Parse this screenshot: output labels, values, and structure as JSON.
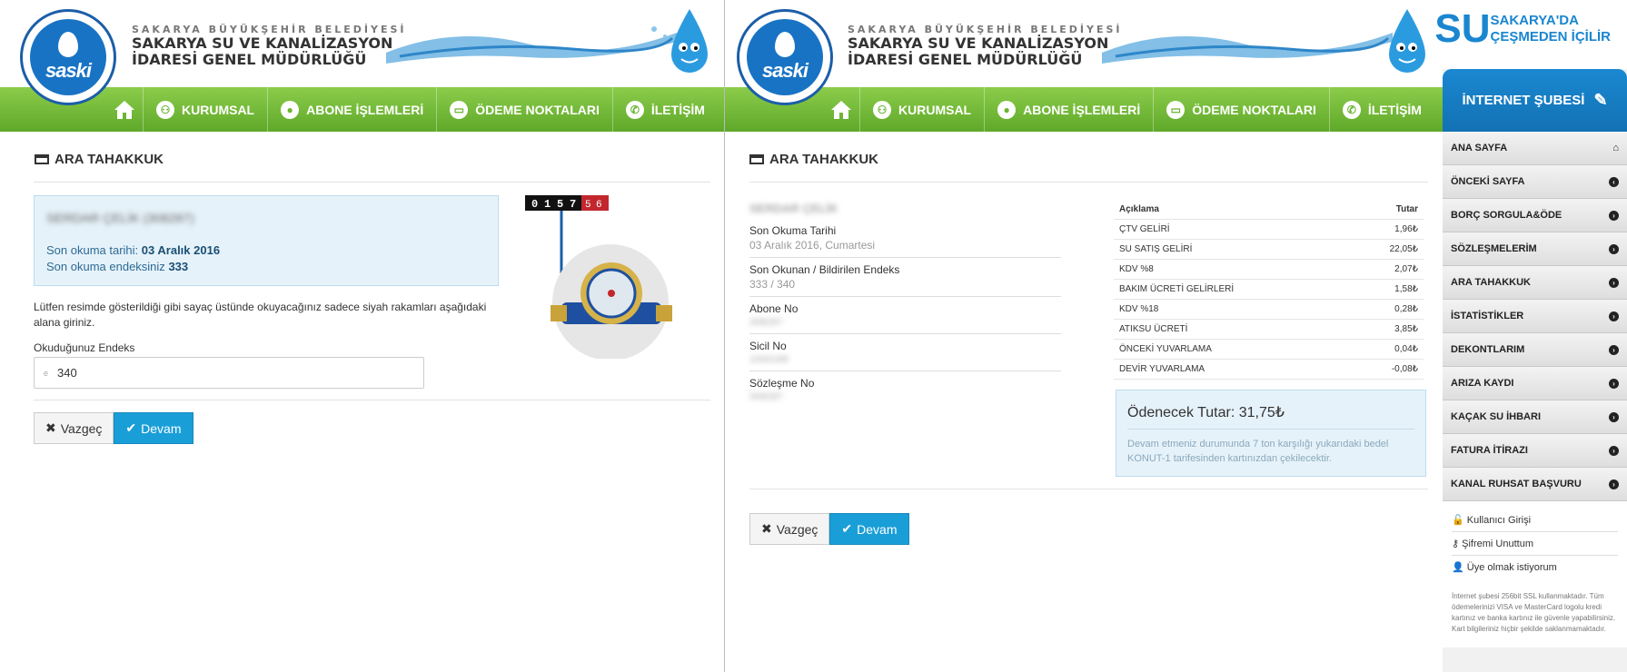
{
  "header": {
    "logo_text": "saski",
    "org_small": "SAKARYA BÜYÜKŞEHİR BELEDİYESİ",
    "org_line1": "SAKARYA SU VE KANALİZASYON",
    "org_line2": "İDARESİ GENEL MÜDÜRLÜĞÜ",
    "slogan_su": "SU",
    "slogan_line1": "SAKARYA'DA",
    "slogan_line2": "ÇEŞMEDEN İÇİLİR"
  },
  "nav": {
    "items": [
      "KURUMSAL",
      "ABONE İŞLEMLERİ",
      "ÖDEME NOKTALARI",
      "İLETİŞİM"
    ]
  },
  "left": {
    "title": "ARA TAHAKKUK",
    "customer_name": "SERDAR ÇELİK (308287)",
    "last_read_label": "Son okuma tarihi:",
    "last_read_value": "03 Aralık 2016",
    "last_index_label": "Son okuma endeksiniz",
    "last_index_value": "333",
    "instruction": "Lütfen resimde gösterildiği gibi sayaç üstünde okuyacağınız sadece siyah rakamları aşağıdaki alana giriniz.",
    "input_label": "Okuduğunuz Endeks",
    "input_prefix": "e",
    "input_value": "340",
    "meter_digits_black": [
      "0",
      "1",
      "5",
      "7"
    ],
    "meter_digits_red": [
      "5",
      "6"
    ],
    "cancel": "Vazgeç",
    "continue": "Devam"
  },
  "right": {
    "title": "ARA TAHAKKUK",
    "customer_name": "SERDAR ÇELİK",
    "fields": [
      {
        "key": "Son Okuma Tarihi",
        "value": "03 Aralık 2016, Cumartesi",
        "blur": false
      },
      {
        "key": "Son Okunan / Bildirilen Endeks",
        "value": "333 / 340",
        "blur": false
      },
      {
        "key": "Abone No",
        "value": "308287",
        "blur": true
      },
      {
        "key": "Sicil No",
        "value": "1000189",
        "blur": true
      },
      {
        "key": "Sözleşme No",
        "value": "308287",
        "blur": true
      }
    ],
    "table_head": {
      "desc": "Açıklama",
      "amount": "Tutar"
    },
    "table_rows": [
      {
        "desc": "ÇTV GELİRİ",
        "amount": "1,96₺"
      },
      {
        "desc": "SU SATIŞ GELİRİ",
        "amount": "22,05₺"
      },
      {
        "desc": "KDV %8",
        "amount": "2,07₺"
      },
      {
        "desc": "BAKIM ÜCRETİ GELİRLERİ",
        "amount": "1,58₺"
      },
      {
        "desc": "KDV %18",
        "amount": "0,28₺"
      },
      {
        "desc": "ATIKSU ÜCRETİ",
        "amount": "3,85₺"
      },
      {
        "desc": "ÖNCEKİ YUVARLAMA",
        "amount": "0,04₺"
      },
      {
        "desc": "DEVİR YUVARLAMA",
        "amount": "-0,08₺"
      }
    ],
    "pay_title": "Ödenecek Tutar: 31,75₺",
    "pay_desc": "Devam etmeniz durumunda 7 ton karşılığı yukarıdaki bedel KONUT-1 tarifesinden kartınızdan çekilecektir.",
    "cancel": "Vazgeç",
    "continue": "Devam"
  },
  "sidebar": {
    "title": "İNTERNET ŞUBESİ",
    "items": [
      "ANA SAYFA",
      "ÖNCEKİ SAYFA",
      "BORÇ SORGULA&ÖDE",
      "SÖZLEŞMELERİM",
      "ARA TAHAKKUK",
      "İSTATİSTİKLER",
      "DEKONTLARIM",
      "ARIZA KAYDI",
      "KAÇAK SU İHBARI",
      "FATURA İTİRAZI",
      "KANAL RUHSAT BAŞVURU"
    ],
    "links": [
      "Kullanıcı Girişi",
      "Şifremi Unuttum",
      "Üye olmak istiyorum"
    ],
    "note": "İnternet şubesi 256bit SSL kullanmaktadır. Tüm ödemelerinizi VISA ve MasterCard logolu kredi kartınız ve banka kartınız ile güvenle yapabilirsiniz. Kart bilgileriniz hiçbir şekilde saklanmamaktadır."
  }
}
